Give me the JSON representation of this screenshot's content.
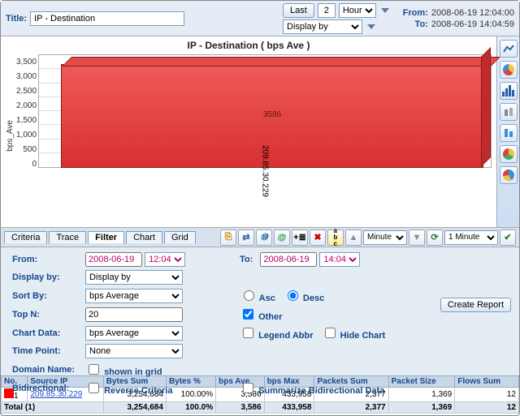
{
  "top": {
    "title_label": "Title:",
    "title_value": "IP - Destination",
    "last_btn": "Last",
    "last_n": "2",
    "last_unit": "Hour",
    "display_by": "Display by",
    "from_label": "From:",
    "from_value": "2008-06-19 12:04:00",
    "to_label": "To:",
    "to_value": "2008-06-19 14:04:59"
  },
  "chart_data": {
    "type": "bar",
    "title": "IP - Destination ( bps Ave )",
    "ylabel": "bps_Ave",
    "categories": [
      "209.85.30.229"
    ],
    "values": [
      3586
    ],
    "yticks": [
      "3,500",
      "3,000",
      "2,500",
      "2,000",
      "1,500",
      "1,000",
      "500",
      "0"
    ],
    "ylim": [
      0,
      3700
    ]
  },
  "tabs": {
    "items": [
      "Criteria",
      "Trace",
      "Filter",
      "Chart",
      "Grid"
    ],
    "active": "Filter",
    "minute_sel_short": "Minute",
    "minute_sel_long": "1 Minute"
  },
  "filter": {
    "from_label": "From:",
    "from_date": "2008-06-19",
    "from_time": "12:04",
    "to_label": "To:",
    "to_date": "2008-06-19",
    "to_time": "14:04",
    "display_by_label": "Display by:",
    "display_by_value": "Display by",
    "sort_by_label": "Sort By:",
    "sort_by_value": "bps Average",
    "asc": "Asc",
    "desc": "Desc",
    "topn_label": "Top N:",
    "topn_value": "20",
    "other_label": "Other",
    "chart_data_label": "Chart Data:",
    "chart_data_value": "bps Average",
    "legend_abbr": "Legend Abbr",
    "hide_chart": "Hide Chart",
    "time_point_label": "Time Point:",
    "time_point_value": "None",
    "domain_name_label": "Domain Name:",
    "shown_in_grid": "shown in grid",
    "bidir_label": "Bidirectional:",
    "reverse": "Reverse Criteria",
    "summarize": "Summarize Bidirectional Data",
    "create_report": "Create Report"
  },
  "table": {
    "headers": [
      "No.",
      "Source IP",
      "Bytes Sum",
      "Bytes %",
      "bps Ave",
      "bps Max",
      "Packets Sum",
      "Packet Size",
      "Flows Sum"
    ],
    "row": {
      "no": "1",
      "ip": "209.85.30.229",
      "bytes_sum": "3,254,684",
      "bytes_pct": "100.00%",
      "bps_ave": "3,586",
      "bps_max": "433,958",
      "packets_sum": "2,377",
      "packet_size": "1,369",
      "flows_sum": "12"
    },
    "total": {
      "label": "Total (1)",
      "bytes_sum": "3,254,684",
      "bytes_pct": "100.0%",
      "bps_ave": "3,586",
      "bps_max": "433,958",
      "packets_sum": "2,377",
      "packet_size": "1,369",
      "flows_sum": "12"
    }
  }
}
